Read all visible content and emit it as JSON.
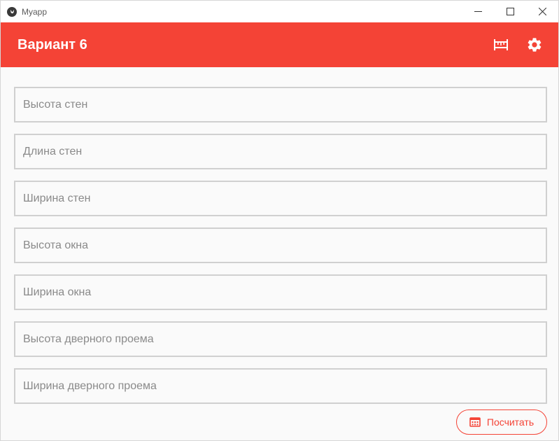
{
  "window": {
    "title": "Myapp",
    "icons": {
      "app": "kivy-logo-icon",
      "minimize": "minimize-icon",
      "maximize": "maximize-icon",
      "close": "close-icon"
    }
  },
  "appbar": {
    "title": "Вариант 6",
    "background": "#f44336",
    "actions": [
      {
        "icon": "ruler-icon"
      },
      {
        "icon": "gear-icon"
      }
    ]
  },
  "form": {
    "fields": [
      {
        "placeholder": "Высота стен",
        "value": ""
      },
      {
        "placeholder": "Длина стен",
        "value": ""
      },
      {
        "placeholder": "Ширина стен",
        "value": ""
      },
      {
        "placeholder": "Высота окна",
        "value": ""
      },
      {
        "placeholder": "Ширина окна",
        "value": ""
      },
      {
        "placeholder": "Высота дверного проема",
        "value": ""
      },
      {
        "placeholder": "Ширина дверного проема",
        "value": ""
      }
    ],
    "submit": {
      "label": "Посчитать",
      "icon": "calculator-icon",
      "color": "#f44336"
    }
  }
}
